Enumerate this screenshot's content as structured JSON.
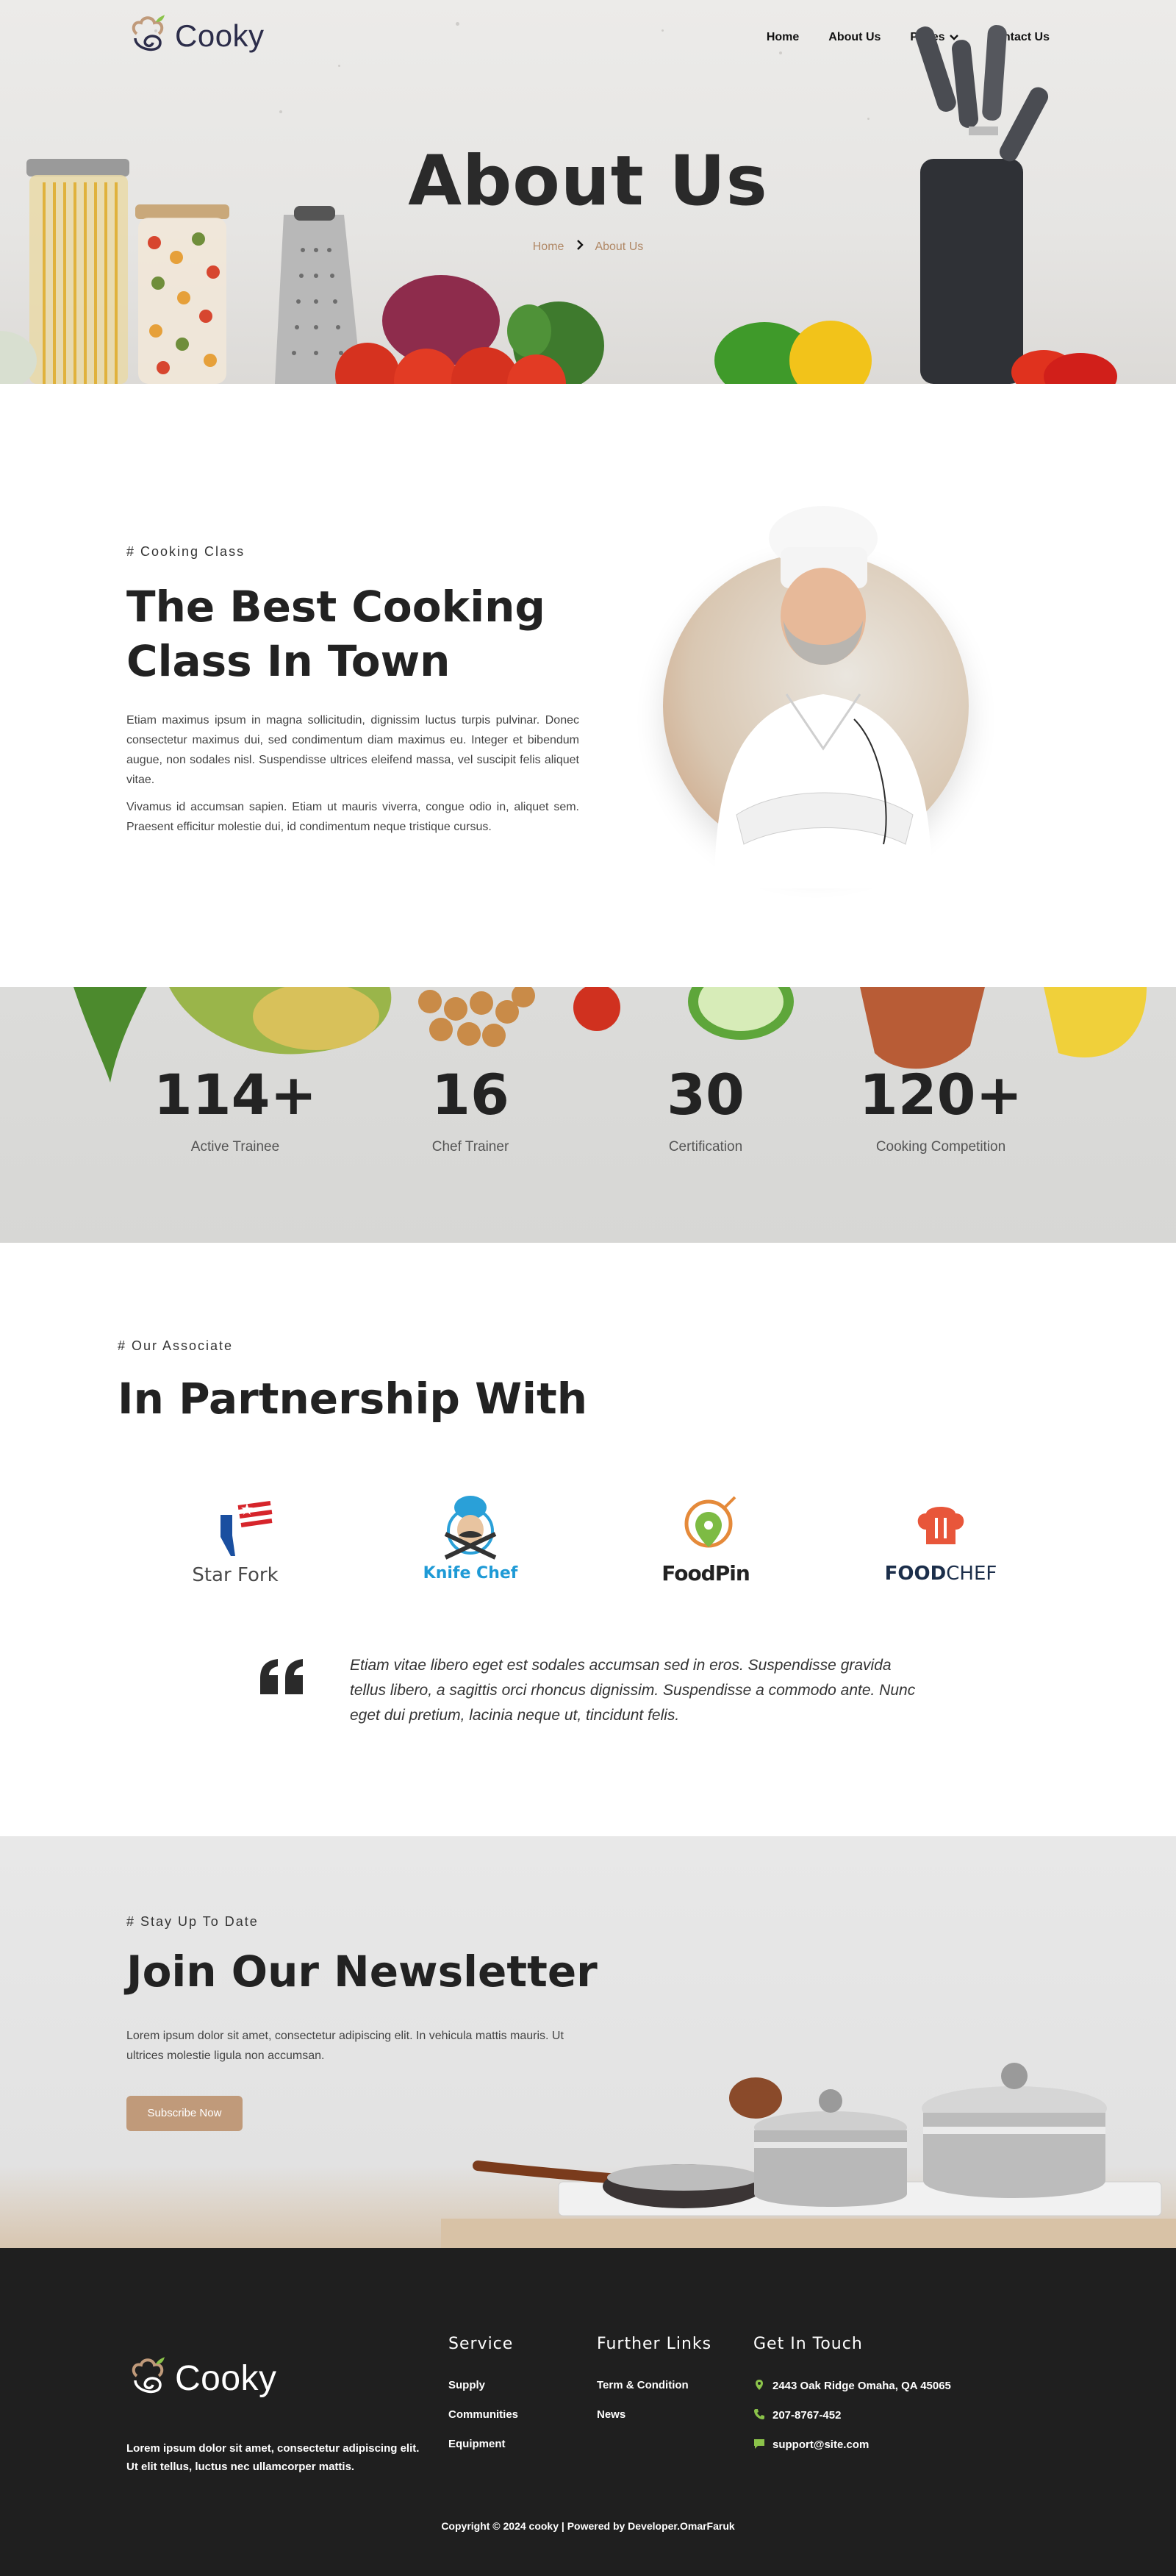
{
  "brand": {
    "name": "Cooky",
    "accent": "#c09a7a",
    "dark": "#2c2d4a"
  },
  "nav": {
    "items": [
      {
        "label": "Home"
      },
      {
        "label": "About Us"
      },
      {
        "label": "Pages",
        "has_dropdown": true
      },
      {
        "label": "Contact Us"
      }
    ]
  },
  "hero": {
    "title": "About Us",
    "breadcrumb": {
      "home": "Home",
      "current": "About Us"
    }
  },
  "about": {
    "eyebrow": "# Cooking Class",
    "title_line1": "The Best Cooking",
    "title_line2": "Class In Town",
    "p1": "Etiam maximus ipsum in magna sollicitudin, dignissim luctus turpis pulvinar. Donec consectetur maximus dui, sed condimentum diam maximus eu. Integer et bibendum augue, non sodales nisl. Suspendisse ultrices eleifend massa, vel suscipit felis aliquet vitae.",
    "p2": "Vivamus id accumsan sapien. Etiam ut mauris viverra, congue odio in, aliquet sem. Praesent efficitur molestie dui, id condimentum neque tristique cursus."
  },
  "stats": [
    {
      "value": "114+",
      "label": "Active Trainee"
    },
    {
      "value": "16",
      "label": "Chef Trainer"
    },
    {
      "value": "30",
      "label": "Certification"
    },
    {
      "value": "120+",
      "label": "Cooking Competition"
    }
  ],
  "partners": {
    "eyebrow": "# Our Associate",
    "title": "In Partnership With",
    "logos": [
      {
        "name": "Star Fork"
      },
      {
        "name": "Knife Chef"
      },
      {
        "name": "FoodPin"
      },
      {
        "name_part1": "FOOD",
        "name_part2": "CHEF"
      }
    ],
    "quote": "Etiam vitae libero eget est sodales accumsan sed in eros. Suspendisse gravida tellus libero, a sagittis orci rhoncus dignissim. Suspendisse a commodo ante. Nunc eget dui pretium, lacinia neque ut, tincidunt felis."
  },
  "newsletter": {
    "eyebrow": "# Stay Up To Date",
    "title": "Join Our Newsletter",
    "text": "Lorem ipsum dolor sit amet, consectetur adipiscing elit. In vehicula mattis mauris. Ut ultrices molestie ligula non accumsan.",
    "button": "Subscribe Now"
  },
  "footer": {
    "about": "Lorem ipsum dolor sit amet, consectetur adipiscing elit. Ut elit tellus, luctus nec ullamcorper mattis.",
    "service": {
      "title": "Service",
      "links": [
        "Supply",
        "Communities",
        "Equipment"
      ]
    },
    "further": {
      "title": "Further Links",
      "links": [
        "Term & Condition",
        "News"
      ]
    },
    "contact": {
      "title": "Get In Touch",
      "address": "2443 Oak Ridge Omaha, QA 45065",
      "phone": "207-8767-452",
      "email": "support@site.com",
      "icon_color": "#8bc34a"
    },
    "copyright": "Copyright © 2024 cooky | Powered by Developer.OmarFaruk"
  }
}
